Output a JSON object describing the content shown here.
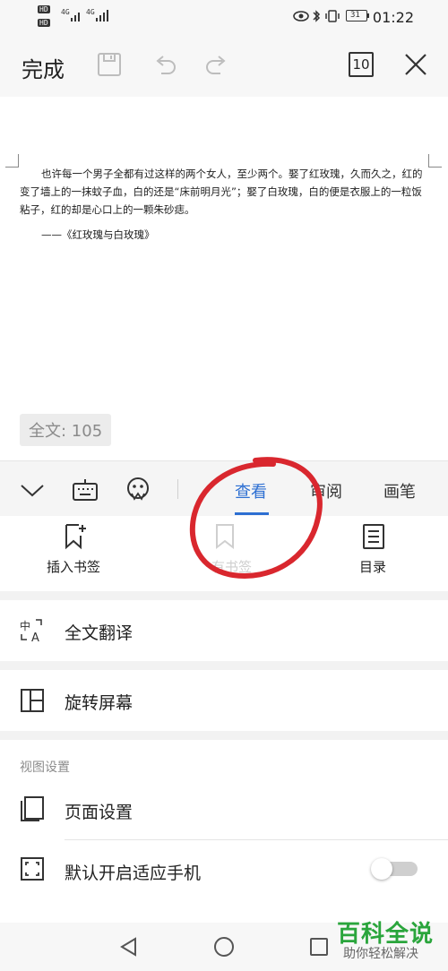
{
  "status_bar": {
    "hd1": "HD",
    "hd2": "HD",
    "net1": "4G",
    "net2": "4G",
    "battery": "31",
    "time": "01:22"
  },
  "toolbar": {
    "done_label": "完成",
    "page_count": "10"
  },
  "document": {
    "paragraph": "也许每一个男子全都有过这样的两个女人，至少两个。娶了红玫瑰，久而久之，红的变了墙上的一抹蚊子血，白的还是“床前明月光”；娶了白玫瑰，白的便是衣服上的一粒饭粘子，红的却是心口上的一颗朱砂痣。",
    "source": "——《红玫瑰与白玫瑰》",
    "word_count": "全文: 105"
  },
  "tabs": [
    {
      "label": "查看",
      "active": true
    },
    {
      "label": "审阅",
      "active": false
    },
    {
      "label": "画笔",
      "active": false
    }
  ],
  "actions": [
    {
      "label": "插入书签"
    },
    {
      "label": "有书签"
    },
    {
      "label": "目录"
    }
  ],
  "menu": {
    "translate": "全文翻译",
    "rotate": "旋转屏幕",
    "section_title": "视图设置",
    "page_settings": "页面设置",
    "fit_phone": "默认开启适应手机",
    "fit_phone_on": false
  },
  "watermark": {
    "title": "百科全说",
    "subtitle": "助你轻松解决"
  },
  "colors": {
    "accent": "#2d6fd2",
    "annotation_circle": "#d9272e",
    "watermark_green": "#2aa53c"
  }
}
